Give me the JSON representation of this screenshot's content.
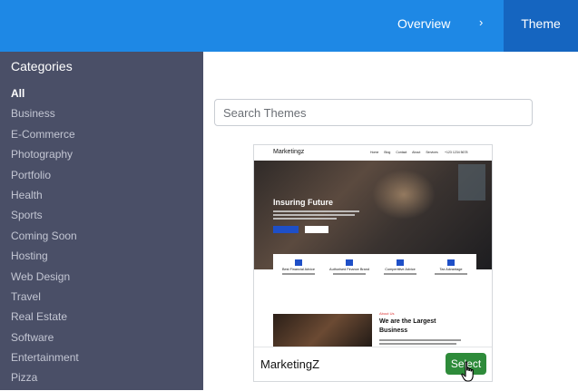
{
  "header": {
    "overview_label": "Overview",
    "chevron": "›",
    "theme_tab_label": "Theme",
    "brand_color": "#1e88e5",
    "active_tab_color": "#1565c0"
  },
  "sidebar": {
    "title": "Categories",
    "items": [
      {
        "label": "All"
      },
      {
        "label": "Business"
      },
      {
        "label": "E-Commerce"
      },
      {
        "label": "Photography"
      },
      {
        "label": "Portfolio"
      },
      {
        "label": "Health"
      },
      {
        "label": "Sports"
      },
      {
        "label": "Coming Soon"
      },
      {
        "label": "Hosting"
      },
      {
        "label": "Web Design"
      },
      {
        "label": "Travel"
      },
      {
        "label": "Real Estate"
      },
      {
        "label": "Software"
      },
      {
        "label": "Entertainment"
      },
      {
        "label": "Pizza"
      }
    ],
    "background_color": "#4a4f67"
  },
  "search": {
    "placeholder": "Search Themes",
    "value": ""
  },
  "theme_card": {
    "name": "MarketingZ",
    "select_label": "Select",
    "select_color": "#2e8b3a",
    "preview": {
      "logo": "Marketingz",
      "menu": [
        "Home",
        "Blog",
        "Contact",
        "About",
        "Services"
      ],
      "phone": "+123 1234 5678",
      "hero_title": "Insuring Future",
      "features": [
        "Best Financial Advice",
        "Authorised Finance Brand",
        "Compertitive Advice",
        "Tax Advantage"
      ],
      "about_label": "About Us",
      "about_heading": "We are the Largest Business"
    }
  }
}
